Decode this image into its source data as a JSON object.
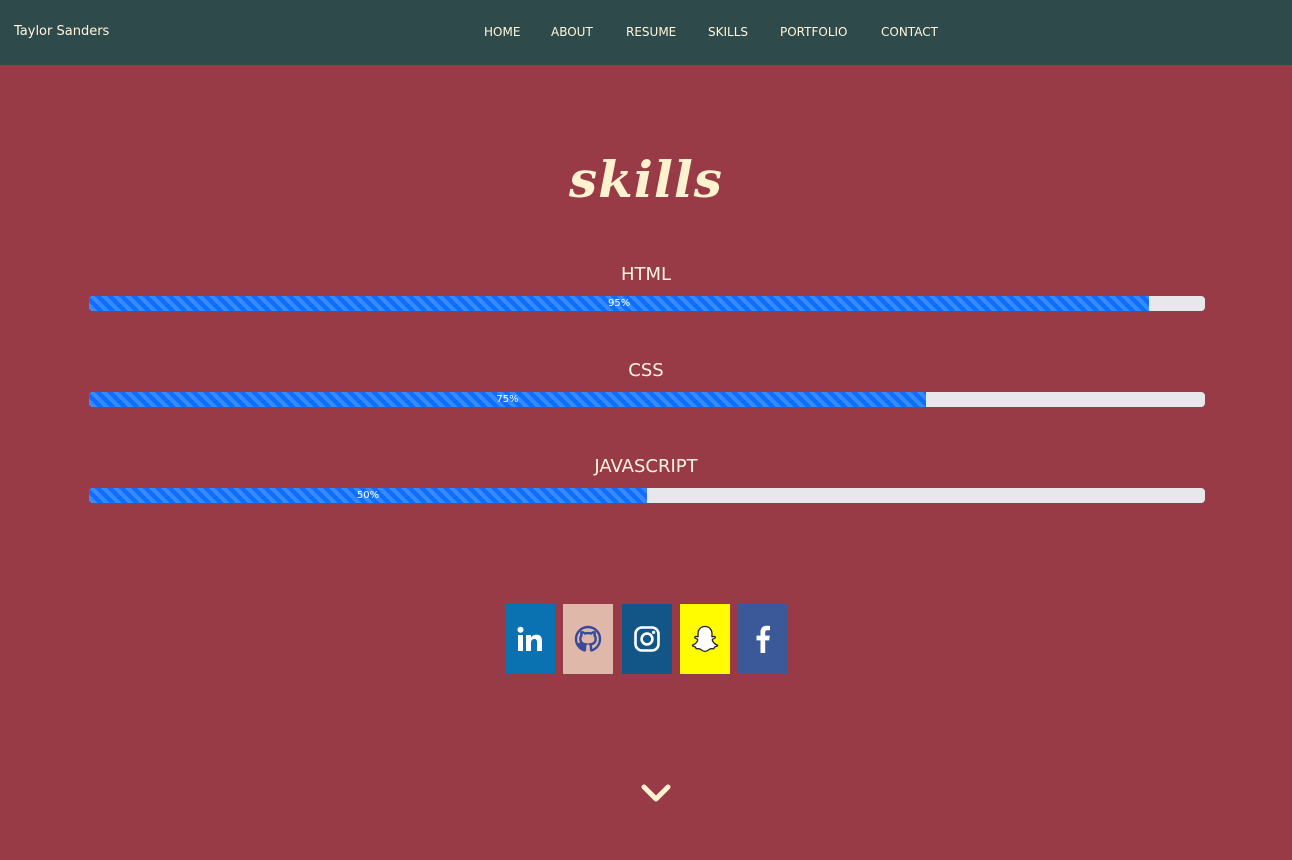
{
  "brand": "Taylor Sanders",
  "nav": {
    "items": [
      {
        "label": "HOME"
      },
      {
        "label": "ABOUT"
      },
      {
        "label": "RESUME"
      },
      {
        "label": "SKILLS"
      },
      {
        "label": "PORTFOLIO"
      },
      {
        "label": "CONTACT"
      }
    ]
  },
  "section": {
    "title": "skills"
  },
  "skills": [
    {
      "name": "HTML",
      "percent_label": "95%",
      "percent": 95
    },
    {
      "name": "CSS",
      "percent_label": "75%",
      "percent": 75
    },
    {
      "name": "JAVASCRIPT",
      "percent_label": "50%",
      "percent": 50
    }
  ],
  "social": [
    {
      "icon": "linkedin-icon",
      "color": "#0a72b1"
    },
    {
      "icon": "github-icon",
      "color": "#dfb8aa"
    },
    {
      "icon": "instagram-icon",
      "color": "#125688"
    },
    {
      "icon": "snapchat-icon",
      "color": "#fffc00"
    },
    {
      "icon": "facebook-icon",
      "color": "#3b5998"
    }
  ],
  "colors": {
    "navbar": "#2e4a4a",
    "background": "#993a47",
    "accent_text": "#fff3cf",
    "progress_fill": "#0d6efd",
    "progress_track": "#e6e8eb"
  },
  "scroll_indicator": {
    "icon": "chevron-down-icon"
  }
}
